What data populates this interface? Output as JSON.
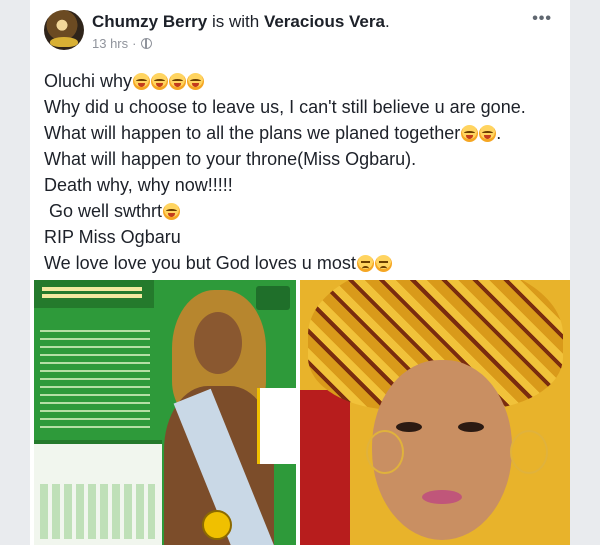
{
  "post": {
    "author": "Chumzy Berry",
    "with_text": " is with ",
    "tagged": "Veracious Vera",
    "end_punct": ".",
    "time": "13 hrs",
    "separator": "·",
    "privacy_icon": "globe-icon",
    "more_label": "•••"
  },
  "lines": [
    {
      "text": "Oluchi why",
      "emoji": [
        "cry",
        "cry",
        "cry",
        "cry"
      ],
      "suffix": ""
    },
    {
      "text": "Why did u choose to leave us, I can't still believe u are gone.",
      "emoji": [],
      "suffix": ""
    },
    {
      "text": "What will happen to all the plans we planed together",
      "emoji": [
        "cry",
        "cry"
      ],
      "suffix": "."
    },
    {
      "text": "What will happen to your throne(Miss Ogbaru).",
      "emoji": [],
      "suffix": ""
    },
    {
      "text": "Death why, why now!!!!!",
      "emoji": [],
      "suffix": ""
    },
    {
      "text": " Go well swthrt",
      "emoji": [
        "cry"
      ],
      "suffix": ""
    },
    {
      "text": "RIP Miss Ogbaru",
      "emoji": [],
      "suffix": ""
    },
    {
      "text": "We love love you but God loves u most",
      "emoji": [
        "sad",
        "sad"
      ],
      "suffix": ""
    }
  ],
  "photos": [
    {
      "name": "pageant-flyer-photo"
    },
    {
      "name": "portrait-photo"
    }
  ],
  "colors": {
    "text": "#1d2129",
    "meta": "#90949c",
    "emoji": "#ffd460"
  }
}
